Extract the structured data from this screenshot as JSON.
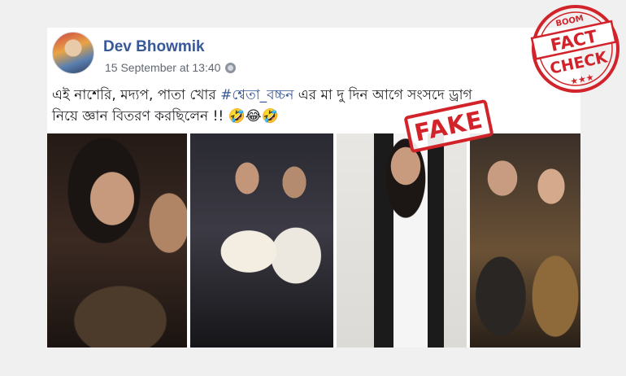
{
  "post": {
    "author": "Dev Bhowmik",
    "timestamp": "15 September at 13:40",
    "text_line1_before": "এই নাশেরি, মদ্যপ, পাতা খোর ",
    "hashtag": "#শ্বেতা_বচ্চন",
    "text_line1_after": " এর মা দু দিন আগে সংসদে ড্রাগ",
    "text_line2": "নিয়ে জ্ঞান বিতরণ করছিলেন !! 🤣😂🤣"
  },
  "overlay": {
    "fake_label": "FAKE"
  },
  "seal": {
    "brand": "BOOM",
    "fact": "FACT",
    "check": "CHECK",
    "stars": "★★★"
  },
  "colors": {
    "author_blue": "#385898",
    "stamp_red": "#d2232a"
  }
}
